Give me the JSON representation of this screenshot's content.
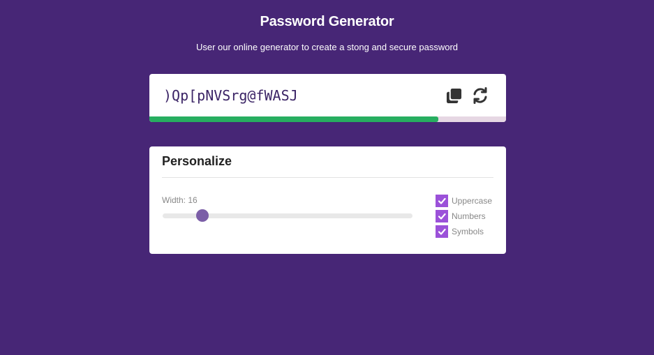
{
  "header": {
    "title": "Password Generator",
    "subtitle": "User our online generator to create a stong and secure password"
  },
  "password": {
    "value": ")Qp[pNVSrg@fWASJ",
    "strength_fraction": 0.81,
    "strength_color": "#27ae60",
    "copy_icon": "copy-icon",
    "refresh_icon": "refresh-icon"
  },
  "settings": {
    "title": "Personalize",
    "width_label": "Width: 16",
    "width_value": 16,
    "slider_fraction": 0.16,
    "options": [
      {
        "label": "Uppercase",
        "checked": true
      },
      {
        "label": "Numbers",
        "checked": true
      },
      {
        "label": "Symbols",
        "checked": true
      }
    ]
  },
  "colors": {
    "background": "#472676",
    "accent": "#9b51d9",
    "thumb": "#7b5ea7"
  }
}
